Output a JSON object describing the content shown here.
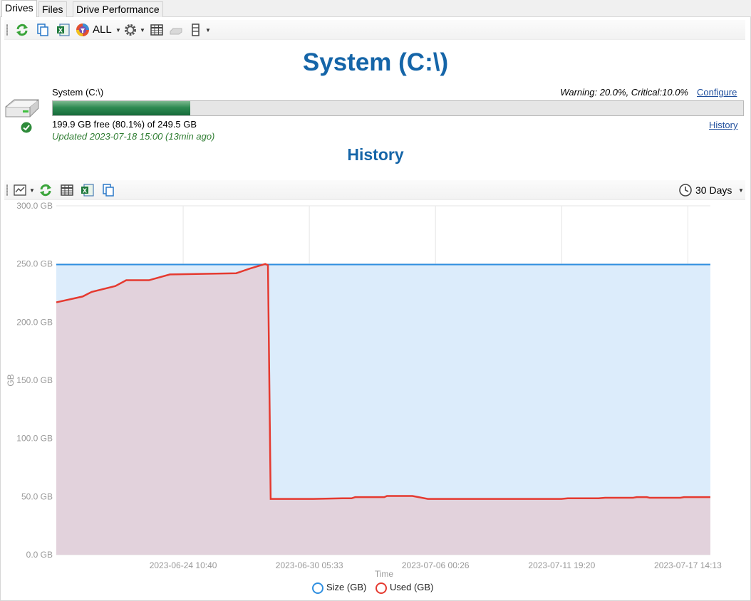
{
  "tabs": [
    {
      "label": "Drives",
      "active": true
    },
    {
      "label": "Files",
      "active": false
    },
    {
      "label": "Drive Performance",
      "active": false
    }
  ],
  "toolbar": {
    "filter_label": "ALL",
    "icons": [
      "refresh-icon",
      "copy-icon",
      "excel-export-icon",
      "filter-icon",
      "settings-icon",
      "table-icon",
      "drive-icon",
      "columns-icon"
    ]
  },
  "header": {
    "title": "System (C:\\)"
  },
  "drive": {
    "name": "System (C:\\)",
    "warning_text": "Warning: 20.0%, Critical:10.0%",
    "configure_label": "Configure",
    "history_link": "History",
    "free_text": "199.9 GB free (80.1%) of 249.5 GB",
    "updated_text": "Updated 2023-07-18 15:00 (13min ago)",
    "used_fraction": 0.199,
    "status": "ok"
  },
  "history": {
    "title": "History",
    "range_label": "30 Days"
  },
  "colors": {
    "title": "#1565a8",
    "size_series": "#2f8fe0",
    "used_series": "#e53a30",
    "size_fill": "#dcecfb",
    "used_fill": "#e2d2dc"
  },
  "chart_data": {
    "type": "area",
    "xlabel": "Time",
    "ylabel": "GB",
    "ylim": [
      0,
      300
    ],
    "yticks": [
      "0.0 GB",
      "50.0 GB",
      "100.0 GB",
      "150.0 GB",
      "200.0 GB",
      "250.0 GB",
      "300.0 GB"
    ],
    "xlim": [
      "2023-06-18 15:00",
      "2023-07-18 15:00"
    ],
    "xticks": [
      "2023-06-24 10:40",
      "2023-06-30 05:33",
      "2023-07-06 00:26",
      "2023-07-11 19:20",
      "2023-07-17 14:13"
    ],
    "grid": true,
    "legend_position": "bottom",
    "series": [
      {
        "name": "Size (GB)",
        "points": [
          [
            "2023-06-18 15:00",
            249.5
          ],
          [
            "2023-07-18 15:00",
            249.5
          ]
        ]
      },
      {
        "name": "Used (GB)",
        "points": [
          [
            "2023-06-18 15:00",
            217
          ],
          [
            "2023-06-19 20:00",
            222
          ],
          [
            "2023-06-20 06:00",
            226
          ],
          [
            "2023-06-21 08:00",
            231
          ],
          [
            "2023-06-21 20:00",
            236
          ],
          [
            "2023-06-22 21:00",
            236
          ],
          [
            "2023-06-23 20:00",
            241
          ],
          [
            "2023-06-26 21:00",
            242
          ],
          [
            "2023-06-27 12:00",
            246
          ],
          [
            "2023-06-28 05:00",
            250
          ],
          [
            "2023-06-28 08:00",
            249
          ],
          [
            "2023-06-28 11:00",
            48
          ],
          [
            "2023-06-30 10:00",
            48
          ],
          [
            "2023-07-01 18:00",
            48.5
          ],
          [
            "2023-07-02 04:00",
            48.5
          ],
          [
            "2023-07-02 08:00",
            49.5
          ],
          [
            "2023-07-03 16:00",
            49.5
          ],
          [
            "2023-07-03 19:00",
            50.5
          ],
          [
            "2023-07-04 23:00",
            50.5
          ],
          [
            "2023-07-05 16:00",
            48
          ],
          [
            "2023-07-11 19:00",
            48
          ],
          [
            "2023-07-12 02:00",
            48.5
          ],
          [
            "2023-07-13 12:00",
            48.5
          ],
          [
            "2023-07-13 19:00",
            49
          ],
          [
            "2023-07-15 02:00",
            49
          ],
          [
            "2023-07-15 06:00",
            49.5
          ],
          [
            "2023-07-15 17:00",
            49.5
          ],
          [
            "2023-07-15 20:00",
            49
          ],
          [
            "2023-07-17 06:00",
            49
          ],
          [
            "2023-07-17 10:00",
            49.5
          ],
          [
            "2023-07-18 15:00",
            49.5
          ]
        ]
      }
    ]
  }
}
